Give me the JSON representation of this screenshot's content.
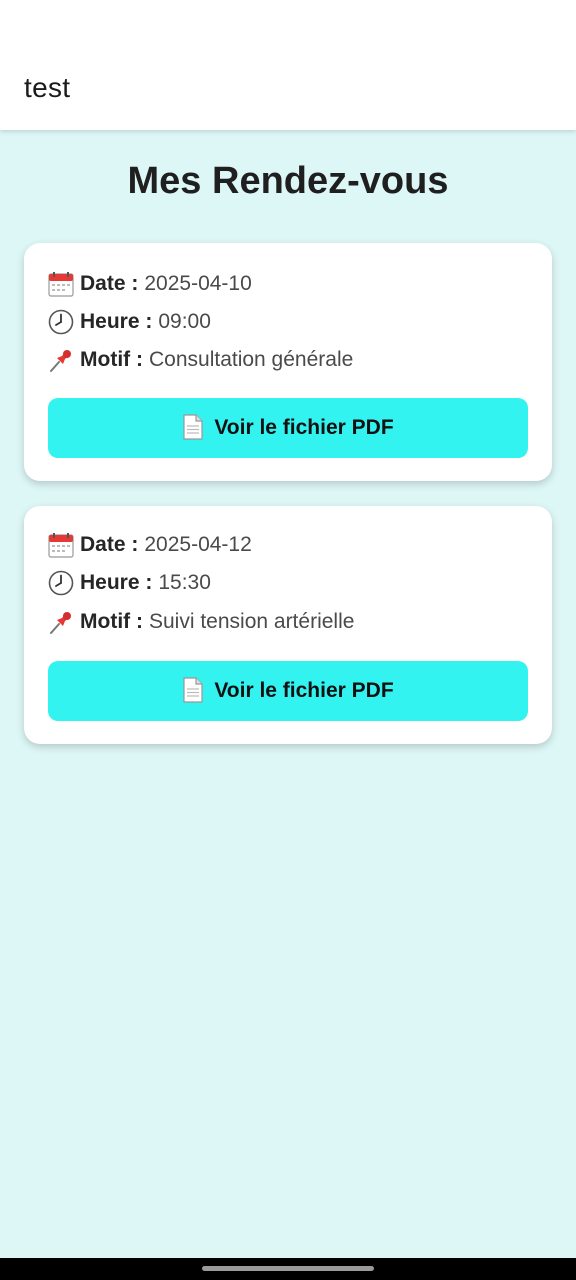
{
  "appbar": {
    "title": "test"
  },
  "page": {
    "title": "Mes Rendez-vous"
  },
  "appointments": [
    {
      "date_label": "Date :",
      "date": "2025-04-10",
      "time_label": "Heure :",
      "time": "09:00",
      "reason_label": "Motif :",
      "reason": "Consultation générale",
      "button_label": "Voir le fichier PDF"
    },
    {
      "date_label": "Date :",
      "date": "2025-04-12",
      "time_label": "Heure :",
      "time": "15:30",
      "reason_label": "Motif :",
      "reason": "Suivi tension artérielle",
      "button_label": "Voir le fichier PDF"
    }
  ],
  "icons": {
    "date": "calendar-icon",
    "time": "clock-icon",
    "reason": "pushpin-icon",
    "button": "document-icon"
  },
  "colors": {
    "background": "#ddf6f6",
    "button": "#33f3f1",
    "card": "#ffffff"
  }
}
